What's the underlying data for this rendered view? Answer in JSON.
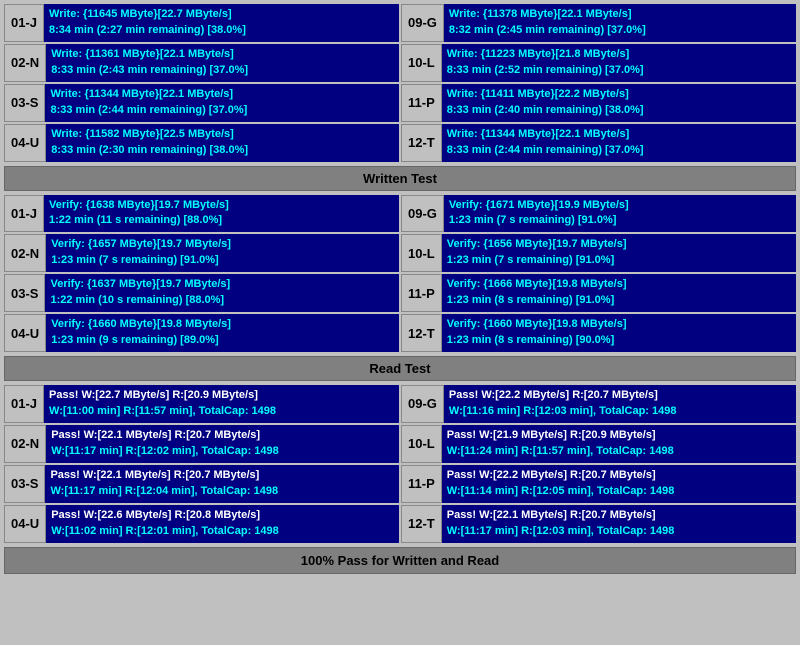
{
  "sections": {
    "write": {
      "rows_left": [
        {
          "id": "01-J",
          "line1": "Write: {11645 MByte}[22.7 MByte/s]",
          "line2": "8:34 min (2:27 min remaining)  [38.0%]"
        },
        {
          "id": "02-N",
          "line1": "Write: {11361 MByte}[22.1 MByte/s]",
          "line2": "8:33 min (2:43 min remaining)  [37.0%]"
        },
        {
          "id": "03-S",
          "line1": "Write: {11344 MByte}[22.1 MByte/s]",
          "line2": "8:33 min (2:44 min remaining)  [37.0%]"
        },
        {
          "id": "04-U",
          "line1": "Write: {11582 MByte}[22.5 MByte/s]",
          "line2": "8:33 min (2:30 min remaining)  [38.0%]"
        }
      ],
      "rows_right": [
        {
          "id": "09-G",
          "line1": "Write: {11378 MByte}[22.1 MByte/s]",
          "line2": "8:32 min (2:45 min remaining)  [37.0%]"
        },
        {
          "id": "10-L",
          "line1": "Write: {11223 MByte}[21.8 MByte/s]",
          "line2": "8:33 min (2:52 min remaining)  [37.0%]"
        },
        {
          "id": "11-P",
          "line1": "Write: {11411 MByte}[22.2 MByte/s]",
          "line2": "8:33 min (2:40 min remaining)  [38.0%]"
        },
        {
          "id": "12-T",
          "line1": "Write: {11344 MByte}[22.1 MByte/s]",
          "line2": "8:33 min (2:44 min remaining)  [37.0%]"
        }
      ],
      "header": "Written Test"
    },
    "verify": {
      "rows_left": [
        {
          "id": "01-J",
          "line1": "Verify: {1638 MByte}[19.7 MByte/s]",
          "line2": "1:22 min (11 s remaining)   [88.0%]"
        },
        {
          "id": "02-N",
          "line1": "Verify: {1657 MByte}[19.7 MByte/s]",
          "line2": "1:23 min (7 s remaining)   [91.0%]"
        },
        {
          "id": "03-S",
          "line1": "Verify: {1637 MByte}[19.7 MByte/s]",
          "line2": "1:22 min (10 s remaining)   [88.0%]"
        },
        {
          "id": "04-U",
          "line1": "Verify: {1660 MByte}[19.8 MByte/s]",
          "line2": "1:23 min (9 s remaining)   [89.0%]"
        }
      ],
      "rows_right": [
        {
          "id": "09-G",
          "line1": "Verify: {1671 MByte}[19.9 MByte/s]",
          "line2": "1:23 min (7 s remaining)   [91.0%]"
        },
        {
          "id": "10-L",
          "line1": "Verify: {1656 MByte}[19.7 MByte/s]",
          "line2": "1:23 min (7 s remaining)   [91.0%]"
        },
        {
          "id": "11-P",
          "line1": "Verify: {1666 MByte}[19.8 MByte/s]",
          "line2": "1:23 min (8 s remaining)   [91.0%]"
        },
        {
          "id": "12-T",
          "line1": "Verify: {1660 MByte}[19.8 MByte/s]",
          "line2": "1:23 min (8 s remaining)   [90.0%]"
        }
      ],
      "header": "Read Test"
    },
    "pass": {
      "rows_left": [
        {
          "id": "01-J",
          "line1": "Pass! W:[22.7 MByte/s] R:[20.9 MByte/s]",
          "line2": "W:[11:00 min] R:[11:57 min], TotalCap: 1498"
        },
        {
          "id": "02-N",
          "line1": "Pass! W:[22.1 MByte/s] R:[20.7 MByte/s]",
          "line2": "W:[11:17 min] R:[12:02 min], TotalCap: 1498"
        },
        {
          "id": "03-S",
          "line1": "Pass! W:[22.1 MByte/s] R:[20.7 MByte/s]",
          "line2": "W:[11:17 min] R:[12:04 min], TotalCap: 1498"
        },
        {
          "id": "04-U",
          "line1": "Pass! W:[22.6 MByte/s] R:[20.8 MByte/s]",
          "line2": "W:[11:02 min] R:[12:01 min], TotalCap: 1498"
        }
      ],
      "rows_right": [
        {
          "id": "09-G",
          "line1": "Pass! W:[22.2 MByte/s] R:[20.7 MByte/s]",
          "line2": "W:[11:16 min] R:[12:03 min], TotalCap: 1498"
        },
        {
          "id": "10-L",
          "line1": "Pass! W:[21.9 MByte/s] R:[20.9 MByte/s]",
          "line2": "W:[11:24 min] R:[11:57 min], TotalCap: 1498"
        },
        {
          "id": "11-P",
          "line1": "Pass! W:[22.2 MByte/s] R:[20.7 MByte/s]",
          "line2": "W:[11:14 min] R:[12:05 min], TotalCap: 1498"
        },
        {
          "id": "12-T",
          "line1": "Pass! W:[22.1 MByte/s] R:[20.7 MByte/s]",
          "line2": "W:[11:17 min] R:[12:03 min], TotalCap: 1498"
        }
      ],
      "footer": "100% Pass for Written and Read"
    }
  }
}
